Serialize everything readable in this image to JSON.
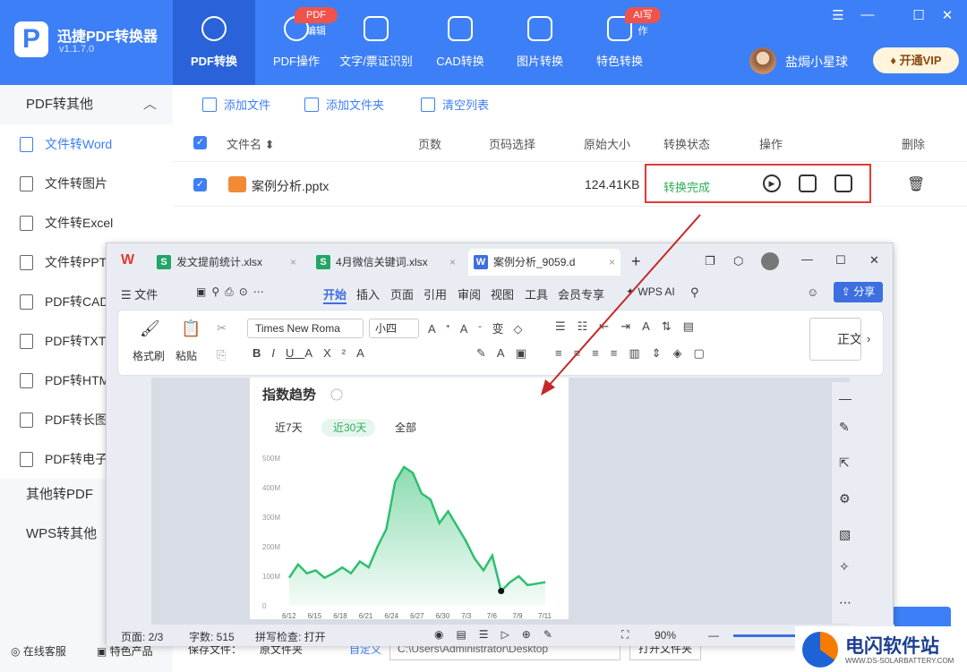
{
  "app": {
    "name": "迅捷PDF转换器",
    "version": "v1.1.7.0"
  },
  "nav": [
    {
      "label": "PDF转换",
      "active": true,
      "icon": "convert-icon"
    },
    {
      "label": "PDF操作",
      "icon": "pdf-operate-icon",
      "badge": "PDF编辑"
    },
    {
      "label": "文字/票证识别",
      "icon": "ocr-icon"
    },
    {
      "label": "CAD转换",
      "icon": "cad-icon"
    },
    {
      "label": "图片转换",
      "icon": "image-icon"
    },
    {
      "label": "特色转换",
      "icon": "special-icon",
      "badge": "AI写作"
    }
  ],
  "user": {
    "name": "盐焗小星球",
    "vip_label": "开通VIP"
  },
  "sidebar": {
    "group1": "PDF转其他",
    "items": [
      "文件转Word",
      "文件转图片",
      "文件转Excel",
      "文件转PPT",
      "PDF转CAD",
      "PDF转TXT",
      "PDF转HTM",
      "PDF转长图",
      "PDF转电子"
    ],
    "group2": "其他转PDF",
    "group3": "WPS转其他",
    "footer": [
      "在线客服",
      "特色产品"
    ]
  },
  "toolbar": {
    "add_file": "添加文件",
    "add_folder": "添加文件夹",
    "clear_list": "清空列表"
  },
  "table": {
    "headers": [
      "文件名 ⬍",
      "页数",
      "页码选择",
      "原始大小",
      "转换状态",
      "操作",
      "删除"
    ],
    "rows": [
      {
        "name": "案例分析.pptx",
        "size": "124.41KB",
        "status": "转换完成"
      }
    ]
  },
  "bottom": {
    "save_label": "保存文件：",
    "orig_folder": "原文件夹",
    "custom": "自定义",
    "path": "C:\\Users\\Administrator\\Desktop",
    "open_folder": "打开文件夹"
  },
  "wps": {
    "tabs": [
      "发文提前统计.xlsx",
      "4月微信关键词.xlsx",
      "案例分析_9059.d"
    ],
    "menu": [
      "文件",
      "开始",
      "插入",
      "页面",
      "引用",
      "审阅",
      "视图",
      "工具",
      "会员专享",
      "WPS AI"
    ],
    "share": "分享",
    "ribbon": {
      "painter": "格式刷",
      "paste": "粘贴",
      "font": "Times New Roma",
      "size": "小四",
      "style": "正文"
    },
    "status": {
      "page": "页面: 2/3",
      "words": "字数: 515",
      "spell": "拼写检查: 打开",
      "zoom": "90%"
    }
  },
  "chart_data": {
    "type": "area",
    "title": "指数趋势",
    "tabs": [
      "近7天",
      "近30天",
      "全部"
    ],
    "active_tab": "近30天",
    "x_ticks": [
      "6/12",
      "6/15",
      "6/18",
      "6/21",
      "6/24",
      "6/27",
      "6/30",
      "7/3",
      "7/6",
      "7/9",
      "7/11"
    ],
    "y_ticks": [
      "0",
      "100M",
      "200M",
      "300M",
      "400M",
      "500M"
    ],
    "ylim": [
      0,
      500
    ],
    "x": [
      1,
      2,
      3,
      4,
      5,
      6,
      7,
      8,
      9,
      10,
      11,
      12,
      13,
      14,
      15,
      16,
      17,
      18,
      19,
      20,
      21,
      22,
      23,
      24,
      25,
      26,
      27,
      28,
      29,
      30
    ],
    "values": [
      95,
      140,
      110,
      120,
      95,
      110,
      130,
      110,
      150,
      130,
      200,
      260,
      420,
      470,
      450,
      380,
      360,
      280,
      320,
      270,
      220,
      160,
      120,
      170,
      50,
      80,
      100,
      70,
      75,
      80
    ],
    "color": "#2fbf71"
  },
  "watermark": {
    "title": "电闪软件站",
    "url": "WWW.DS-SOLARBATTERY.COM"
  }
}
